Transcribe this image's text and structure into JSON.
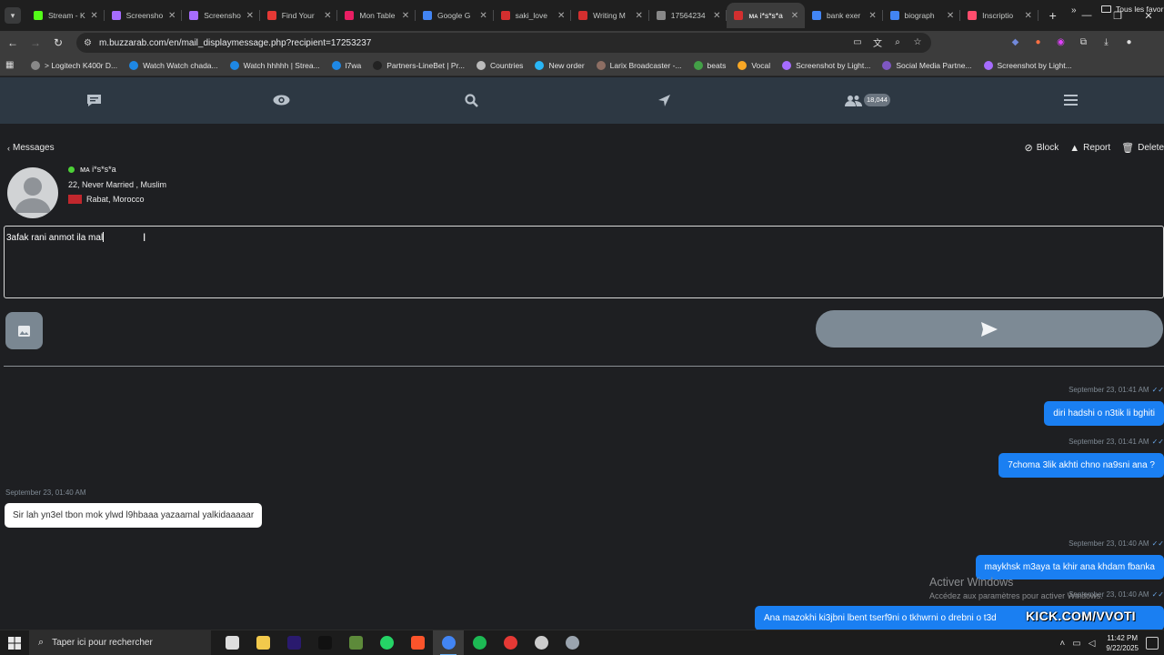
{
  "browser": {
    "tabs": [
      {
        "title": "Stream - K",
        "color": "#53fc18",
        "active": false
      },
      {
        "title": "Screensho",
        "color": "#a66cff",
        "active": false
      },
      {
        "title": "Screensho",
        "color": "#a66cff",
        "active": false
      },
      {
        "title": "Find Your",
        "color": "#e53935",
        "active": false
      },
      {
        "title": "Mon Table",
        "color": "#e91e63",
        "active": false
      },
      {
        "title": "Google G",
        "color": "#4285f4",
        "active": false
      },
      {
        "title": "saki_love",
        "color": "#d32f2f",
        "active": false
      },
      {
        "title": "Writing M",
        "color": "#d32f2f",
        "active": false
      },
      {
        "title": "17564234",
        "color": "#888888",
        "active": false
      },
      {
        "title": "ᴍᴀ i*s*s*a",
        "color": "#d32f2f",
        "active": true
      },
      {
        "title": "bank exer",
        "color": "#4285f4",
        "active": false
      },
      {
        "title": "biograph",
        "color": "#4285f4",
        "active": false
      },
      {
        "title": "Inscriptio",
        "color": "#ff4d6d",
        "active": false
      }
    ],
    "url": "m.buzzarab.com/en/mail_displaymessage.php?recipient=17253237",
    "bookmarks": [
      {
        "label": "> Logitech K400r D...",
        "color": "#888888"
      },
      {
        "label": "Watch Watch chada...",
        "color": "#1e88e5"
      },
      {
        "label": "Watch hhhhh | Strea...",
        "color": "#1e88e5"
      },
      {
        "label": "l7wa",
        "color": "#1e88e5"
      },
      {
        "label": "Partners-LineBet | Pr...",
        "color": "#222222"
      },
      {
        "label": "Countries",
        "color": "#bbbbbb"
      },
      {
        "label": "New order",
        "color": "#29b6f6"
      },
      {
        "label": "Larix Broadcaster -...",
        "color": "#8d6e63"
      },
      {
        "label": "beats",
        "color": "#43a047"
      },
      {
        "label": "Vocal",
        "color": "#f9a825"
      },
      {
        "label": "Screenshot by Light...",
        "color": "#a66cff"
      },
      {
        "label": "Social Media Partne...",
        "color": "#7e57c2"
      },
      {
        "label": "Screenshot by Light...",
        "color": "#a66cff"
      }
    ],
    "bookmarks_folder": "Tous les favoris"
  },
  "site": {
    "members_badge": "18,044",
    "back_label": "Messages",
    "actions": {
      "block": "Block",
      "report": "Report",
      "delete": "Delete"
    }
  },
  "profile": {
    "name": "ᴍᴀ i*s*s*a",
    "meta": "22, Never Married , Muslim",
    "location": "Rabat, Morocco",
    "online": true
  },
  "compose": {
    "text": "3afak rani anmot ila mal"
  },
  "messages": [
    {
      "dir": "out",
      "time": "September 23, 01:41 AM",
      "text": "diri hadshi o n3tik li bghiti"
    },
    {
      "dir": "out",
      "time": "September 23, 01:41 AM",
      "text": "7choma 3lik akhti chno na9sni ana ?"
    },
    {
      "dir": "in",
      "time": "September 23, 01:40 AM",
      "text": "Sir lah yn3el tbon mok ylwd l9hbaaa yazaamal yalkidaaaaar"
    },
    {
      "dir": "out",
      "time": "September 23, 01:40 AM",
      "text": "maykhsk m3aya ta khir ana khdam fbanka"
    },
    {
      "dir": "out",
      "time": "September 23, 01:40 AM",
      "text": "Ana mazokhi ki3jbni lbent tserf9ni o tkhwrni o drebni o t3d"
    }
  ],
  "overlay": {
    "windows_line1": "Activer Windows",
    "windows_line2": "Accédez aux paramètres pour activer Windows.",
    "kick": "KICK.COM/VVOTI"
  },
  "taskbar": {
    "search_placeholder": "Taper ici pour rechercher",
    "time": "11:42 PM",
    "date": "9/22/2025",
    "apps": [
      {
        "name": "task-view",
        "color": "#dddddd",
        "active": false
      },
      {
        "name": "file-explorer",
        "color": "#f2c94c",
        "active": false
      },
      {
        "name": "premiere-pro",
        "color": "#2a1a6e",
        "active": false
      },
      {
        "name": "tiktok",
        "color": "#111111",
        "active": false
      },
      {
        "name": "minecraft",
        "color": "#5d8a3a",
        "active": false
      },
      {
        "name": "whatsapp",
        "color": "#25d366",
        "active": false
      },
      {
        "name": "brave",
        "color": "#fb542b",
        "active": false
      },
      {
        "name": "chrome",
        "color": "#4285f4",
        "active": true
      },
      {
        "name": "spotify",
        "color": "#1db954",
        "active": false
      },
      {
        "name": "recorder",
        "color": "#e53935",
        "active": false
      },
      {
        "name": "obs",
        "color": "#cccccc",
        "active": false
      },
      {
        "name": "steam",
        "color": "#9aa4ae",
        "active": false
      }
    ]
  }
}
